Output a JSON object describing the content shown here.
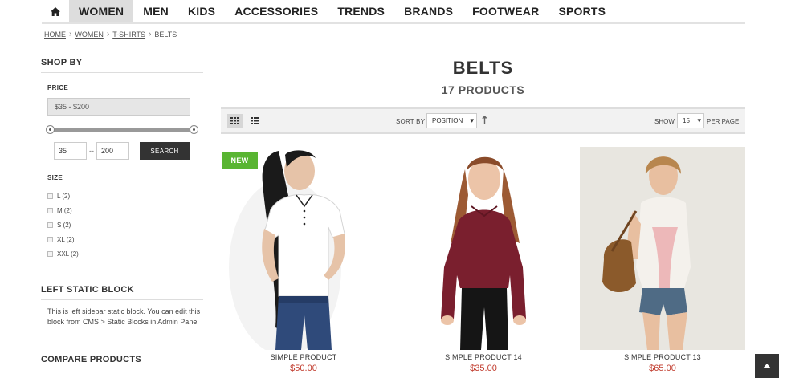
{
  "nav": {
    "home_icon": "home-icon",
    "items": [
      "WOMEN",
      "MEN",
      "KIDS",
      "ACCESSORIES",
      "TRENDS",
      "BRANDS",
      "FOOTWEAR",
      "SPORTS"
    ]
  },
  "breadcrumb": {
    "items": [
      "HOME",
      "WOMEN",
      "T-SHIRTS"
    ],
    "current": "BELTS"
  },
  "sidebar": {
    "shop_by": "SHOP BY",
    "price": {
      "title": "PRICE",
      "range_label": "$35 - $200",
      "min": "35",
      "separator": "--",
      "max": "200",
      "search_label": "SEARCH"
    },
    "size": {
      "title": "SIZE",
      "options": [
        "L (2)",
        "M (2)",
        "S (2)",
        "XL (2)",
        "XXL (2)"
      ]
    },
    "static_block": {
      "title": "LEFT STATIC BLOCK",
      "text": "This is left sidebar static block. You can edit this block from CMS > Static Blocks in Admin Panel"
    },
    "compare_title": "COMPARE PRODUCTS"
  },
  "main": {
    "title": "BELTS",
    "count": "17 PRODUCTS",
    "toolbar": {
      "sort_by_label": "SORT BY",
      "sort_value": "POSITION",
      "sort_dir_icon": "arrow-up-icon",
      "show_label": "SHOW",
      "show_value": "15",
      "per_page_label": "PER PAGE"
    },
    "products": [
      {
        "name": "SIMPLE PRODUCT",
        "price": "$50.00",
        "badge": "NEW"
      },
      {
        "name": "SIMPLE PRODUCT 14",
        "price": "$35.00"
      },
      {
        "name": "SIMPLE PRODUCT 13",
        "price": "$65.00"
      }
    ]
  },
  "colors": {
    "accent_price": "#c0392b",
    "new_badge": "#59b532",
    "dark_button": "#333333"
  }
}
